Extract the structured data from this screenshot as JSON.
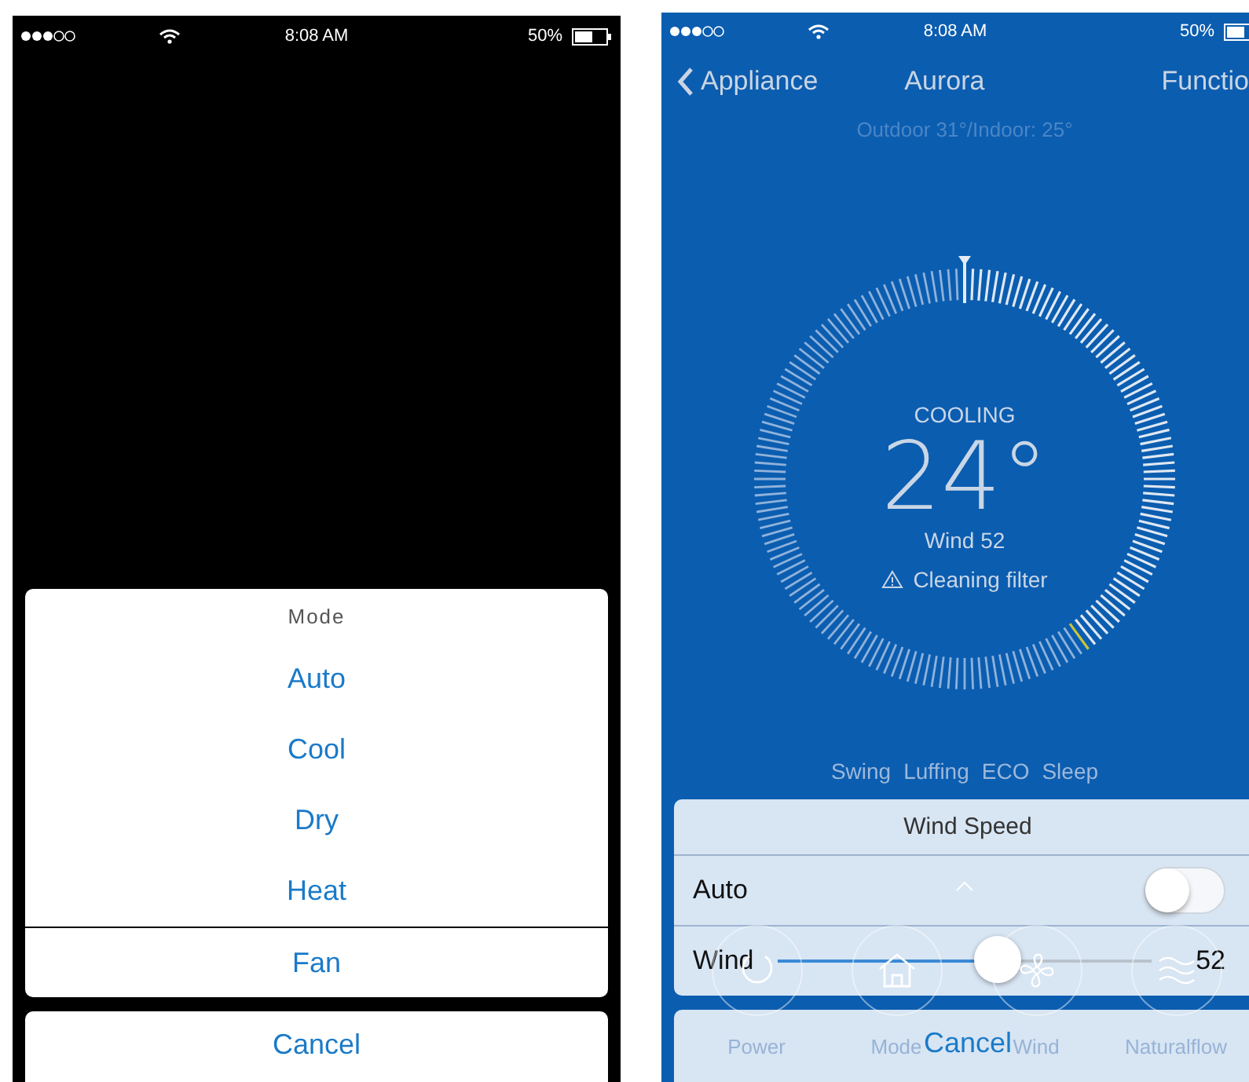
{
  "mode_screen": {
    "status_bar": {
      "time": "8:08 AM",
      "battery": "50%"
    },
    "mode_sheet": {
      "title": "Mode",
      "options": [
        {
          "label": "Auto",
          "divider_above": false
        },
        {
          "label": "Cool",
          "divider_above": false
        },
        {
          "label": "Dry",
          "divider_above": false
        },
        {
          "label": "Heat",
          "divider_above": false
        },
        {
          "label": "Fan",
          "divider_above": true
        }
      ]
    },
    "cancel": "Cancel"
  },
  "control_screen": {
    "status_bar": {
      "time": "8:08 AM",
      "battery": "50%"
    },
    "nav": {
      "back": "Appliance",
      "title": "Aurora",
      "action": "Functio"
    },
    "climate": "Outdoor 31°/Indoor: 25°",
    "dial": {
      "mode": "COOLING",
      "temperature": "24°",
      "wind": "Wind 52",
      "alert": "Cleaning filter"
    },
    "features": [
      "Swing",
      "Luffing",
      "ECO",
      "Sleep"
    ],
    "controls": [
      {
        "label": "Power"
      },
      {
        "label": "Mode"
      },
      {
        "label": "Wind"
      },
      {
        "label": "Naturalflow"
      }
    ],
    "wind_sheet": {
      "title": "Wind Speed",
      "auto": {
        "label": "Auto",
        "on": false
      },
      "wind": {
        "label": "Wind",
        "level": 0.58,
        "reading": "52"
      }
    },
    "cancel": "Cancel"
  }
}
